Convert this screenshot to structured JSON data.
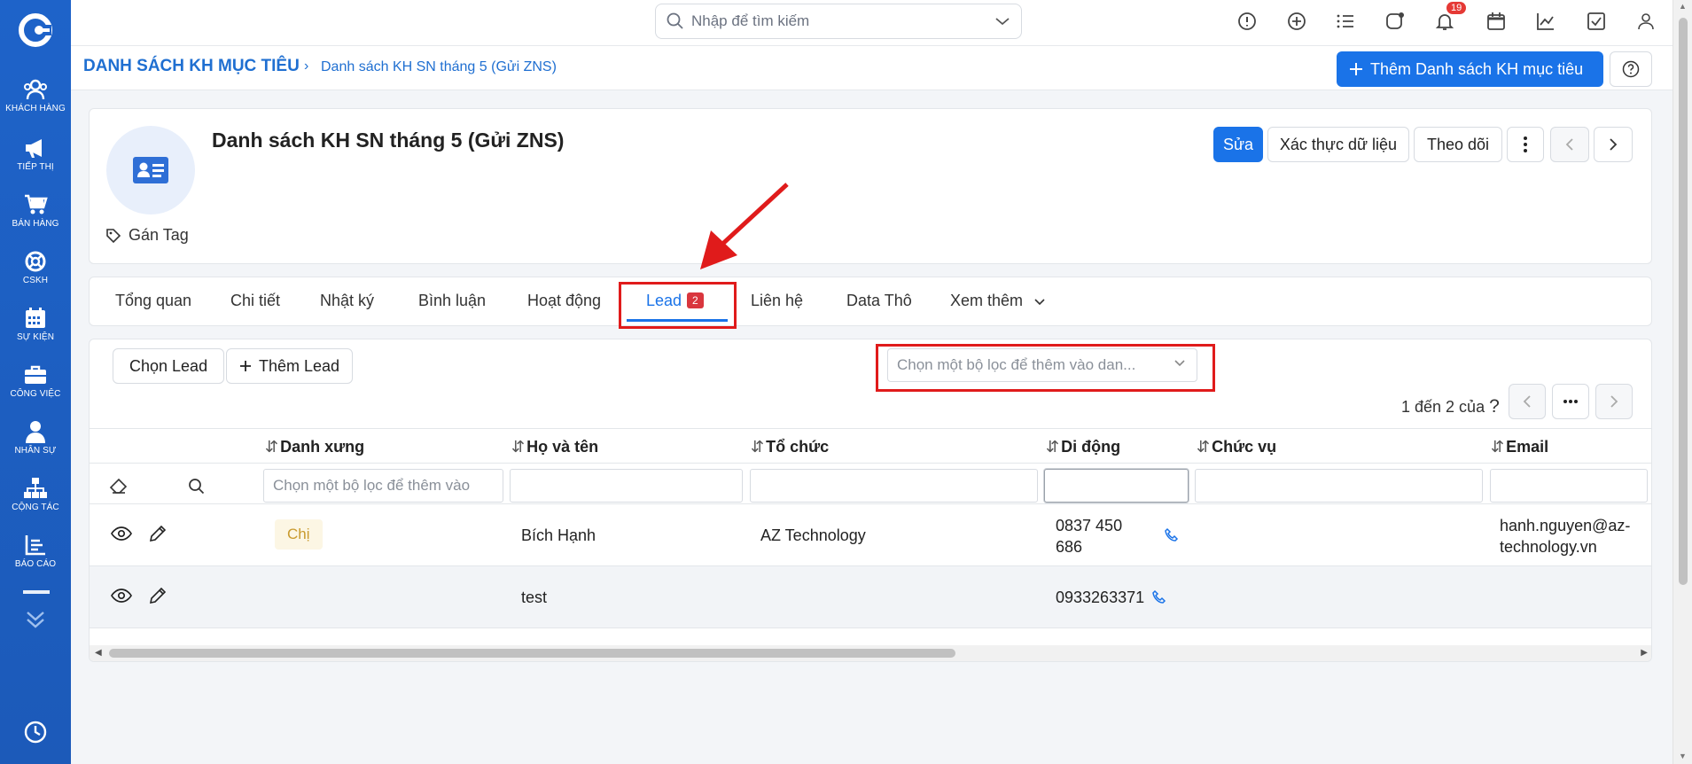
{
  "sidebar": {
    "items": [
      {
        "label": "KHÁCH HÀNG",
        "icon": "users-icon"
      },
      {
        "label": "TIẾP THỊ",
        "icon": "megaphone-icon"
      },
      {
        "label": "BÁN HÀNG",
        "icon": "cart-icon"
      },
      {
        "label": "CSKH",
        "icon": "lifebuoy-icon"
      },
      {
        "label": "SỰ KIỆN",
        "icon": "calendar-icon"
      },
      {
        "label": "CÔNG VIỆC",
        "icon": "briefcase-icon"
      },
      {
        "label": "NHÂN SỰ",
        "icon": "person-icon"
      },
      {
        "label": "CỘNG TÁC",
        "icon": "org-chart-icon"
      },
      {
        "label": "BÁO CÁO",
        "icon": "report-icon"
      }
    ]
  },
  "topbar": {
    "search_placeholder": "Nhập để tìm kiếm",
    "notification_count": "19"
  },
  "breadcrumb": {
    "root": "DANH SÁCH KH MỤC TIÊU",
    "separator": "›",
    "current": "Danh sách KH SN tháng 5 (Gửi ZNS)"
  },
  "add_button_label": "Thêm Danh sách KH mục tiêu",
  "record": {
    "title": "Danh sách KH SN tháng 5 (Gửi ZNS)",
    "tag_label": "Gán Tag",
    "actions": {
      "edit": "Sửa",
      "verify": "Xác thực dữ liệu",
      "follow": "Theo dõi"
    }
  },
  "tabs": [
    {
      "label": "Tổng quan"
    },
    {
      "label": "Chi tiết"
    },
    {
      "label": "Nhật ký"
    },
    {
      "label": "Bình luận"
    },
    {
      "label": "Hoạt động"
    },
    {
      "label": "Lead",
      "badge": "2",
      "active": true
    },
    {
      "label": "Liên hệ"
    },
    {
      "label": "Data Thô"
    },
    {
      "label": "Xem thêm"
    }
  ],
  "lead_panel": {
    "select_lead": "Chọn Lead",
    "add_lead": "Thêm Lead",
    "filter_placeholder": "Chọn một bộ lọc để thêm vào dan...",
    "pager_text": "1 đến 2 của",
    "pager_unknown": "?"
  },
  "table": {
    "columns": [
      "Danh xưng",
      "Họ và tên",
      "Tổ chức",
      "Di động",
      "Chức vụ",
      "Email"
    ],
    "salutation_filter_placeholder": "Chọn một bộ lọc để thêm vào",
    "rows": [
      {
        "salutation": "Chị",
        "name": "Bích Hạnh",
        "org": "AZ Technology",
        "mobile_line1": "0837 450",
        "mobile_line2": "686",
        "position": "",
        "email_line1": "hanh.nguyen@az-",
        "email_line2": "technology.vn"
      },
      {
        "salutation": "",
        "name": "test",
        "org": "",
        "mobile_line1": "0933263371",
        "mobile_line2": "",
        "position": "",
        "email_line1": "",
        "email_line2": ""
      }
    ]
  },
  "colors": {
    "primary": "#1a73e8",
    "sidebar": "#1e63c9",
    "highlight": "#e01b1b",
    "badge": "#d9363e"
  }
}
